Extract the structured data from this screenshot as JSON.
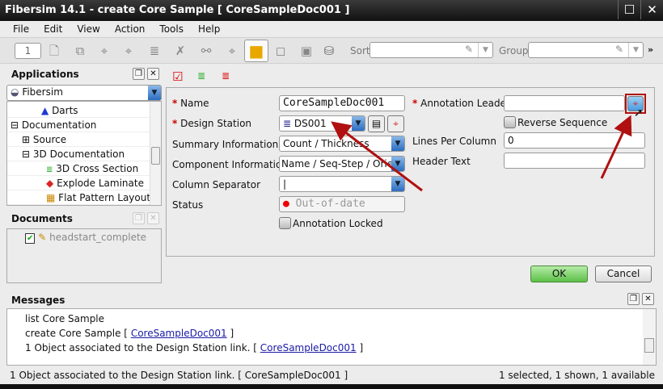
{
  "window": {
    "title": "Fibersim 14.1 - create Core Sample [ CoreSampleDoc001 ]"
  },
  "menu": [
    "File",
    "Edit",
    "View",
    "Action",
    "Tools",
    "Help"
  ],
  "toolbar": {
    "page_number": "1",
    "sort_label": "Sort",
    "sort_value": "",
    "group_label": "Group",
    "group_value": "",
    "overflow": "»"
  },
  "applications": {
    "title": "Applications",
    "selected": "Fibersim",
    "tree": [
      {
        "label": "Darts",
        "icon": "darts-icon"
      },
      {
        "label": "Documentation",
        "icon": "collapse-icon"
      },
      {
        "label": "Source",
        "icon": "expand-icon"
      },
      {
        "label": "3D Documentation",
        "icon": "collapse-icon"
      },
      {
        "label": "3D Cross Section",
        "icon": "cross-section-icon"
      },
      {
        "label": "Explode Laminate",
        "icon": "explode-laminate-icon"
      },
      {
        "label": "Flat Pattern Layout",
        "icon": "flat-pattern-icon"
      }
    ]
  },
  "documents": {
    "title": "Documents",
    "items": [
      {
        "label": "headstart_complete",
        "checked": true
      }
    ]
  },
  "form": {
    "name_label": "Name",
    "name_value": "CoreSampleDoc001",
    "design_station_label": "Design Station",
    "design_station_value": "DS001",
    "summary_label": "Summary Information",
    "summary_value": "Count / Thickness",
    "component_label": "Component Information",
    "component_value": "Name / Seq-Step / Orien",
    "separator_label": "Column Separator",
    "separator_value": "|",
    "status_label": "Status",
    "status_value": "Out-of-date",
    "status_color": "#ee0000",
    "annotation_locked_label": "Annotation Locked",
    "annotation_locked": false,
    "leader_label": "Annotation Leader",
    "leader_value": "",
    "reverse_label": "Reverse Sequence",
    "reverse": false,
    "lines_label": "Lines Per Column",
    "lines_value": "0",
    "header_label": "Header Text",
    "header_value": "",
    "ok": "OK",
    "cancel": "Cancel"
  },
  "messages": {
    "title": "Messages",
    "lines": [
      {
        "text": "list Core Sample",
        "link": "",
        "suffix": ""
      },
      {
        "text": "create Core Sample [ ",
        "link": "CoreSampleDoc001",
        "suffix": " ]"
      },
      {
        "text": "1 Object associated to the Design Station link. [ ",
        "link": "CoreSampleDoc001",
        "suffix": " ]"
      }
    ]
  },
  "status": {
    "left": "1 Object associated to the Design Station link. [ CoreSampleDoc001 ]",
    "right": "1 selected, 1 shown, 1 available"
  },
  "colors": {
    "accent_arrow": "#b01010",
    "ok_green": "#7fd36b"
  }
}
